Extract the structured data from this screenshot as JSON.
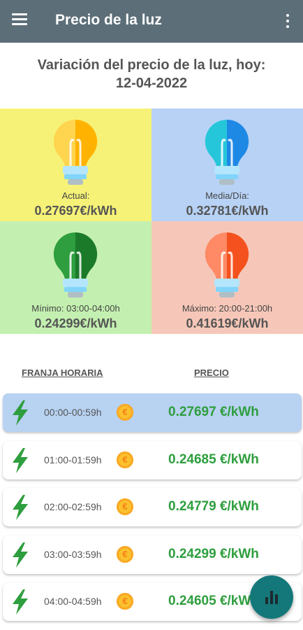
{
  "app": {
    "title": "Precio de la luz"
  },
  "heading": {
    "line1": "Variación del precio de la luz, hoy:",
    "date": "12-04-2022"
  },
  "tiles": [
    {
      "label": "Actual:",
      "value": "0.27697€/kWh",
      "bg": "#f6f278",
      "bulb_left": "#ffd54f",
      "bulb_right": "#ffb300"
    },
    {
      "label": "Media/Día:",
      "value": "0.32781€/kWh",
      "bg": "#b7d2f5",
      "bulb_left": "#26c6da",
      "bulb_right": "#1e88e5"
    },
    {
      "label": "Mínimo: 03:00-04:00h",
      "value": "0.24299€/kWh",
      "bg": "#c3f0b0",
      "bulb_left": "#2e9e3e",
      "bulb_right": "#1b7a2a"
    },
    {
      "label": "Máximo: 20:00-21:00h",
      "value": "0.41619€/kWh",
      "bg": "#f6c7b8",
      "bulb_left": "#ff8a65",
      "bulb_right": "#f4511e"
    }
  ],
  "table": {
    "col_time": "FRANJA HORARIA",
    "col_price": "PRECIO"
  },
  "rows": [
    {
      "time": "00:00-00:59h",
      "price": "0.27697 €/kWh",
      "coin": "€"
    },
    {
      "time": "01:00-01:59h",
      "price": "0.24685 €/kWh",
      "coin": "€"
    },
    {
      "time": "02:00-02:59h",
      "price": "0.24779 €/kWh",
      "coin": "€"
    },
    {
      "time": "03:00-03:59h",
      "price": "0.24299 €/kWh",
      "coin": "€"
    },
    {
      "time": "04:00-04:59h",
      "price": "0.24605 €/kWh",
      "coin": "€"
    }
  ],
  "colors": {
    "appbar": "#5c6e78",
    "price_green": "#2e9e3e",
    "fab": "#14787a",
    "active_row": "#b8d2f2"
  },
  "icons": {
    "menu": "hamburger-icon",
    "more": "more-vert-icon",
    "bolt": "lightning-bolt-icon",
    "coin": "euro-coin-icon",
    "fab": "bar-chart-icon"
  }
}
